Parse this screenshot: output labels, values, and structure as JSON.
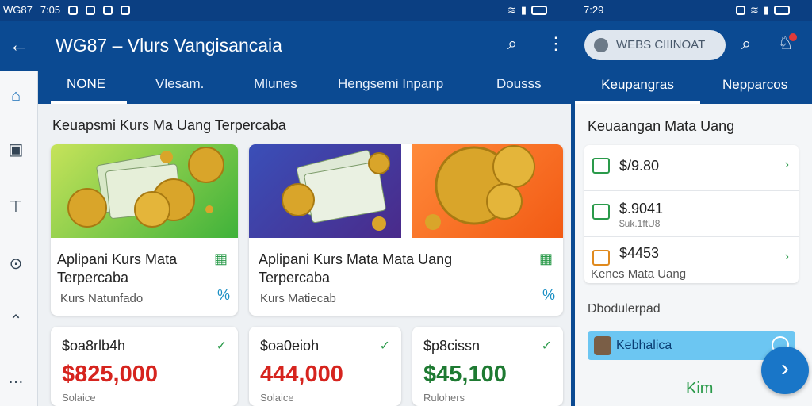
{
  "status": {
    "left_text": "WG87",
    "time": "7:05",
    "time_right": "7:29"
  },
  "header": {
    "title": "WG87 – Vlurs Vangisancaia",
    "tabs": [
      "NONE",
      "Vlesam.",
      "Mlunes",
      "Hengsemi Inpanp",
      "Dousss"
    ]
  },
  "section_title": "Keuapsmi Kurs Ma Uang Terpercaba",
  "cards": [
    {
      "title": "Aplipani Kurs Mata Terpercaba",
      "subtitle": "Kurs Natunfado",
      "pct": "%"
    },
    {
      "title": "Aplipani Kurs Mata Mata Uang Terpercaba",
      "subtitle": "Kurs Matiecab",
      "pct": "%"
    }
  ],
  "prices": [
    {
      "top": "$oa8rlb4h",
      "big": "$825,000",
      "label": "Solaice",
      "color": "#d6241e"
    },
    {
      "top": "$oa0eioh",
      "big": "444,000",
      "label": "Solaice",
      "color": "#d6241e"
    },
    {
      "top": "$p8cissn",
      "big": "$45,100",
      "label": "Rulohers",
      "color": "#1e7a32"
    }
  ],
  "right": {
    "search_label": "WEBS CIIINOAT",
    "tabs": [
      "Keupangras",
      "Nepparcos"
    ],
    "title": "Keuaangan Mata Uang",
    "items": [
      {
        "value": "$/9.80",
        "sub": "",
        "color": "#2a9a4a"
      },
      {
        "value": "$.9041",
        "sub": "$uk.1ftU8",
        "color": "#2a9a4a"
      },
      {
        "value": "$4453",
        "sub": "Kenes Mata Uang",
        "color": "#e08a1e"
      }
    ],
    "foot": "Dbodulerpad",
    "bar_label": "Kebhalica",
    "bottom": "Kim"
  }
}
